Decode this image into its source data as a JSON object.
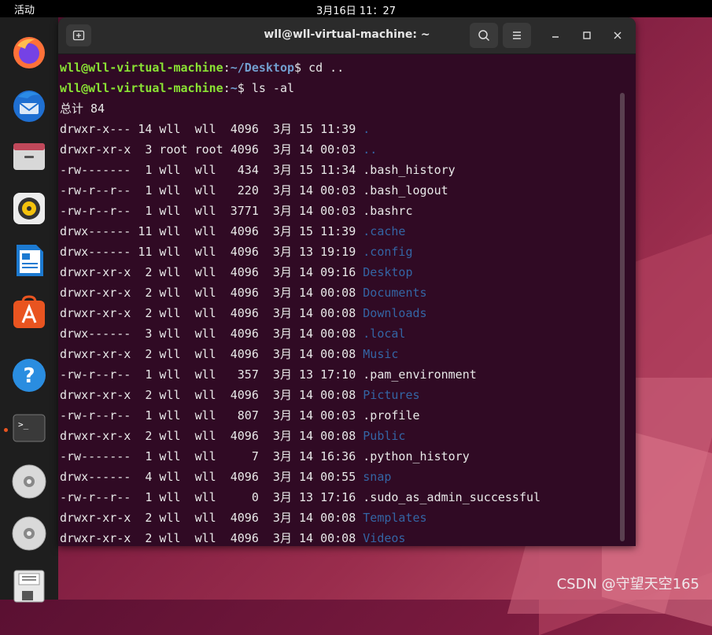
{
  "topbar": {
    "activities": "活动",
    "clock": "3月16日  11：27"
  },
  "dock": {
    "items": [
      {
        "name": "firefox-icon"
      },
      {
        "name": "thunderbird-icon"
      },
      {
        "name": "files-icon"
      },
      {
        "name": "rhythmbox-icon"
      },
      {
        "name": "writer-icon"
      },
      {
        "name": "software-icon"
      },
      {
        "name": "help-icon"
      },
      {
        "name": "terminal-icon"
      },
      {
        "name": "disc-icon"
      },
      {
        "name": "disc-icon"
      },
      {
        "name": "save-icon"
      }
    ]
  },
  "window": {
    "title": "wll@wll-virtual-machine: ~"
  },
  "terminal": {
    "prompt1": {
      "user": "wll@wll-virtual-machine",
      "sep": ":",
      "path": "~/Desktop",
      "cmd": "$ cd .."
    },
    "prompt2": {
      "user": "wll@wll-virtual-machine",
      "sep": ":",
      "path": "~",
      "cmd": "$ ls -al"
    },
    "total": "总计 84",
    "rows": [
      {
        "meta": "drwxr-x--- 14 wll  wll  4096  3月 15 11:39 ",
        "name": ".",
        "dir": true
      },
      {
        "meta": "drwxr-xr-x  3 root root 4096  3月 14 00:03 ",
        "name": "..",
        "dir": true
      },
      {
        "meta": "-rw-------  1 wll  wll   434  3月 15 11:34 ",
        "name": ".bash_history",
        "dir": false
      },
      {
        "meta": "-rw-r--r--  1 wll  wll   220  3月 14 00:03 ",
        "name": ".bash_logout",
        "dir": false
      },
      {
        "meta": "-rw-r--r--  1 wll  wll  3771  3月 14 00:03 ",
        "name": ".bashrc",
        "dir": false
      },
      {
        "meta": "drwx------ 11 wll  wll  4096  3月 15 11:39 ",
        "name": ".cache",
        "dir": true
      },
      {
        "meta": "drwx------ 11 wll  wll  4096  3月 13 19:19 ",
        "name": ".config",
        "dir": true
      },
      {
        "meta": "drwxr-xr-x  2 wll  wll  4096  3月 14 09:16 ",
        "name": "Desktop",
        "dir": true
      },
      {
        "meta": "drwxr-xr-x  2 wll  wll  4096  3月 14 00:08 ",
        "name": "Documents",
        "dir": true
      },
      {
        "meta": "drwxr-xr-x  2 wll  wll  4096  3月 14 00:08 ",
        "name": "Downloads",
        "dir": true
      },
      {
        "meta": "drwx------  3 wll  wll  4096  3月 14 00:08 ",
        "name": ".local",
        "dir": true
      },
      {
        "meta": "drwxr-xr-x  2 wll  wll  4096  3月 14 00:08 ",
        "name": "Music",
        "dir": true
      },
      {
        "meta": "-rw-r--r--  1 wll  wll   357  3月 13 17:10 ",
        "name": ".pam_environment",
        "dir": false
      },
      {
        "meta": "drwxr-xr-x  2 wll  wll  4096  3月 14 00:08 ",
        "name": "Pictures",
        "dir": true
      },
      {
        "meta": "-rw-r--r--  1 wll  wll   807  3月 14 00:03 ",
        "name": ".profile",
        "dir": false
      },
      {
        "meta": "drwxr-xr-x  2 wll  wll  4096  3月 14 00:08 ",
        "name": "Public",
        "dir": true
      },
      {
        "meta": "-rw-------  1 wll  wll     7  3月 14 16:36 ",
        "name": ".python_history",
        "dir": false
      },
      {
        "meta": "drwx------  4 wll  wll  4096  3月 14 00:55 ",
        "name": "snap",
        "dir": true
      },
      {
        "meta": "-rw-r--r--  1 wll  wll     0  3月 13 17:16 ",
        "name": ".sudo_as_admin_successful",
        "dir": false
      },
      {
        "meta": "drwxr-xr-x  2 wll  wll  4096  3月 14 00:08 ",
        "name": "Templates",
        "dir": true
      },
      {
        "meta": "drwxr-xr-x  2 wll  wll  4096  3月 14 00:08 ",
        "name": "Videos",
        "dir": true
      }
    ]
  },
  "watermark": "CSDN @守望天空165"
}
